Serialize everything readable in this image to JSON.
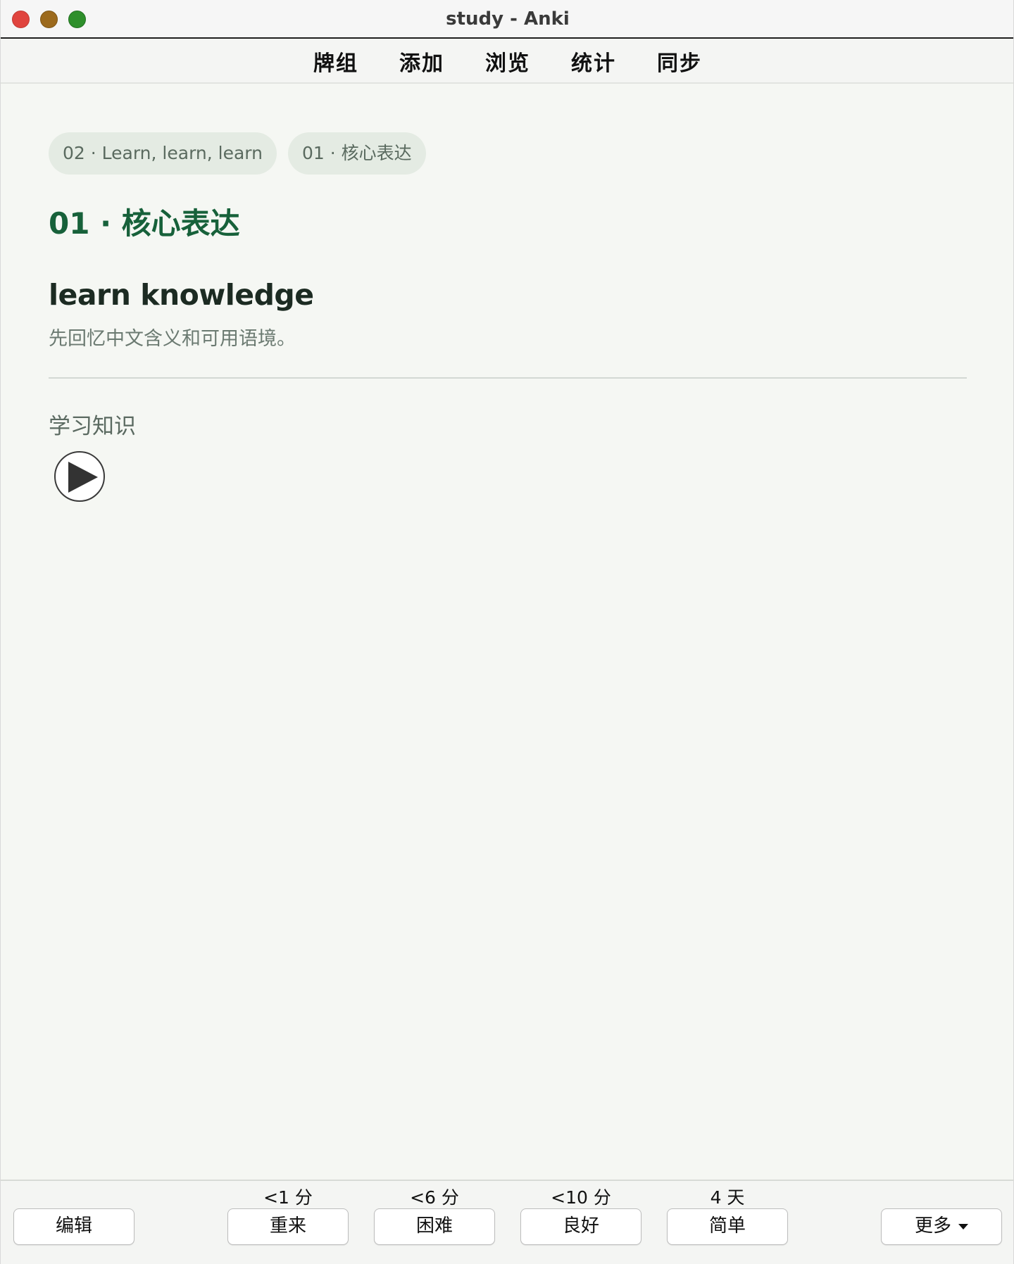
{
  "window": {
    "title": "study - Anki"
  },
  "toolbar": {
    "items": [
      "牌组",
      "添加",
      "浏览",
      "统计",
      "同步"
    ]
  },
  "card": {
    "breadcrumbs": [
      "02 · Learn, learn, learn",
      "01 · 核心表达"
    ],
    "deck_title": "01 · 核心表达",
    "word": "learn knowledge",
    "hint": "先回忆中文含义和可用语境。",
    "answer": "学习知识",
    "audio_icon": "play-icon"
  },
  "bottom": {
    "edit_label": "编辑",
    "more_label": "更多",
    "answers": [
      {
        "label": "重来",
        "due": "<1 分"
      },
      {
        "label": "困难",
        "due": "<6 分"
      },
      {
        "label": "良好",
        "due": "<10 分"
      },
      {
        "label": "简单",
        "due": "4 天"
      }
    ]
  },
  "colors": {
    "accent_green": "#17613a",
    "chip_bg": "#e4ebe3",
    "page_bg": "#f5f7f3"
  }
}
